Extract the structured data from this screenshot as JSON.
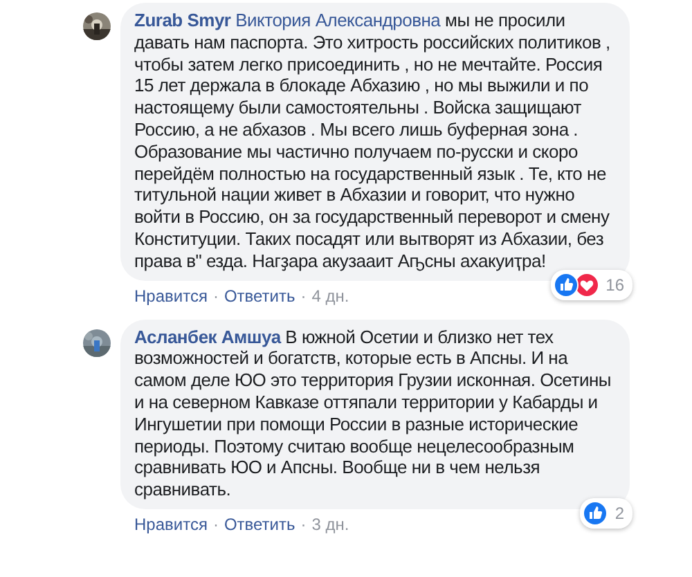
{
  "comments": [
    {
      "author": "Zurab Smyr",
      "mention": "Виктория Александровна",
      "text": "мы не просили давать нам паспорта. Это хитрость российских политиков , чтобы затем легко присоединить , но не мечтайте. Россия 15 лет держала в блокаде Абхазию , но мы выжили и по настоящему были самостоятельны . Войска защищают Россию, а не абхазов . Мы всего лишь буферная зона . Образование мы частично получаем по-русски и скоро перейдём полностью на государственный язык . Те, кто не титульной нации живет в Абхазии и говорит, что нужно войти в Россию, он за государственный переворот и смену Конституции. Таких посадят или вытворят из Абхазии, без права в\" езда. Нагҙара акузааит Аҧсны ахакуиҭра!",
      "reactions": [
        {
          "kind": "like"
        },
        {
          "kind": "love"
        }
      ],
      "reaction_count": "16",
      "like": "Нравится",
      "sep1": "·",
      "reply": "Ответить",
      "sep2": "·",
      "time": "4 дн."
    },
    {
      "author": "Асланбек Амшуа",
      "text": "В южной Осетии и близко нет тех возможностей и богатств, которые есть в Апсны. И на самом деле ЮО это территория Грузии исконная. Осетины и на северном Кавказе оттяпали территории у Кабарды и Ингушетии при помощи России в разные исторические периоды. Поэтому считаю вообще нецелесообразным сравнивать ЮО и Апсны. Вообще ни в чем нельзя сравнивать.",
      "reactions": [
        {
          "kind": "like"
        }
      ],
      "reaction_count": "2",
      "like": "Нравится",
      "sep1": "·",
      "reply": "Ответить",
      "sep2": "·",
      "time": "3 дн."
    }
  ]
}
